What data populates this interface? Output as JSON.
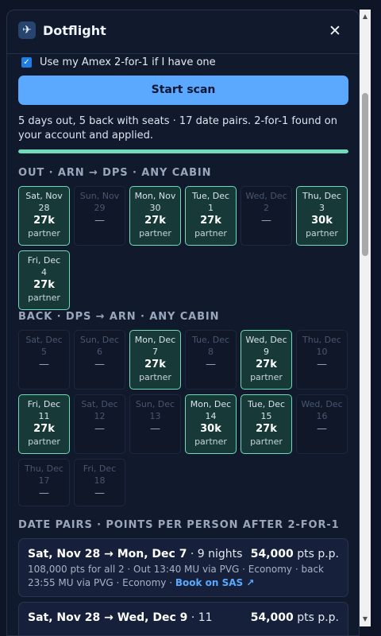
{
  "header": {
    "title": "Dotflight",
    "logo_icon": "plane-icon",
    "close_glyph": "✕"
  },
  "amex": {
    "label": "Use my Amex 2-for-1 if I have one",
    "checked": true
  },
  "scan_button": "Start scan",
  "status": "5 days out, 5 back with seats · 17 date pairs. 2-for-1 found on your account and applied.",
  "progress": 1.0,
  "out": {
    "title": "OUT · ARN → DPS · ANY CABIN",
    "days": [
      {
        "date": "Sat, Nov 28",
        "pts": "27k",
        "tag": "partner",
        "available": true
      },
      {
        "date": "Sun, Nov 29",
        "pts": "—",
        "tag": "",
        "available": false
      },
      {
        "date": "Mon, Nov 30",
        "pts": "27k",
        "tag": "partner",
        "available": true
      },
      {
        "date": "Tue, Dec 1",
        "pts": "27k",
        "tag": "partner",
        "available": true
      },
      {
        "date": "Wed, Dec 2",
        "pts": "—",
        "tag": "",
        "available": false
      },
      {
        "date": "Thu, Dec 3",
        "pts": "30k",
        "tag": "partner",
        "available": true
      },
      {
        "date": "Fri, Dec 4",
        "pts": "27k",
        "tag": "partner",
        "available": true
      }
    ]
  },
  "back": {
    "title": "BACK · DPS → ARN · ANY CABIN",
    "days": [
      {
        "date": "Sat, Dec 5",
        "pts": "—",
        "tag": "",
        "available": false
      },
      {
        "date": "Sun, Dec 6",
        "pts": "—",
        "tag": "",
        "available": false
      },
      {
        "date": "Mon, Dec 7",
        "pts": "27k",
        "tag": "partner",
        "available": true
      },
      {
        "date": "Tue, Dec 8",
        "pts": "—",
        "tag": "",
        "available": false
      },
      {
        "date": "Wed, Dec 9",
        "pts": "27k",
        "tag": "partner",
        "available": true
      },
      {
        "date": "Thu, Dec 10",
        "pts": "—",
        "tag": "",
        "available": false
      },
      {
        "date": "Fri, Dec 11",
        "pts": "27k",
        "tag": "partner",
        "available": true
      },
      {
        "date": "Sat, Dec 12",
        "pts": "—",
        "tag": "",
        "available": false
      },
      {
        "date": "Sun, Dec 13",
        "pts": "—",
        "tag": "",
        "available": false
      },
      {
        "date": "Mon, Dec 14",
        "pts": "30k",
        "tag": "partner",
        "available": true
      },
      {
        "date": "Tue, Dec 15",
        "pts": "27k",
        "tag": "partner",
        "available": true
      },
      {
        "date": "Wed, Dec 16",
        "pts": "—",
        "tag": "",
        "available": false
      },
      {
        "date": "Thu, Dec 17",
        "pts": "—",
        "tag": "",
        "available": false
      },
      {
        "date": "Fri, Dec 18",
        "pts": "—",
        "tag": "",
        "available": false
      }
    ]
  },
  "pairs": {
    "title": "DATE PAIRS · POINTS PER PERSON AFTER 2-FOR-1",
    "items": [
      {
        "dates": "Sat, Nov 28 → Mon, Dec 7",
        "nights": " · 9 nights",
        "pts": "54,000",
        "unit": " pts p.p.",
        "detail": "108,000 pts for all 2 · Out 13:40 MU via PVG · Economy · back 23:55 MU via PVG · Economy · ",
        "link": "Book on SAS ↗"
      },
      {
        "dates": "Sat, Nov 28 → Wed, Dec 9",
        "nights": " · 11",
        "pts": "54,000",
        "unit": " pts p.p.",
        "detail": "",
        "link": ""
      }
    ]
  },
  "colors": {
    "accent": "#5aa8ff",
    "available": "#6fdcb7",
    "background": "#111a2d"
  }
}
